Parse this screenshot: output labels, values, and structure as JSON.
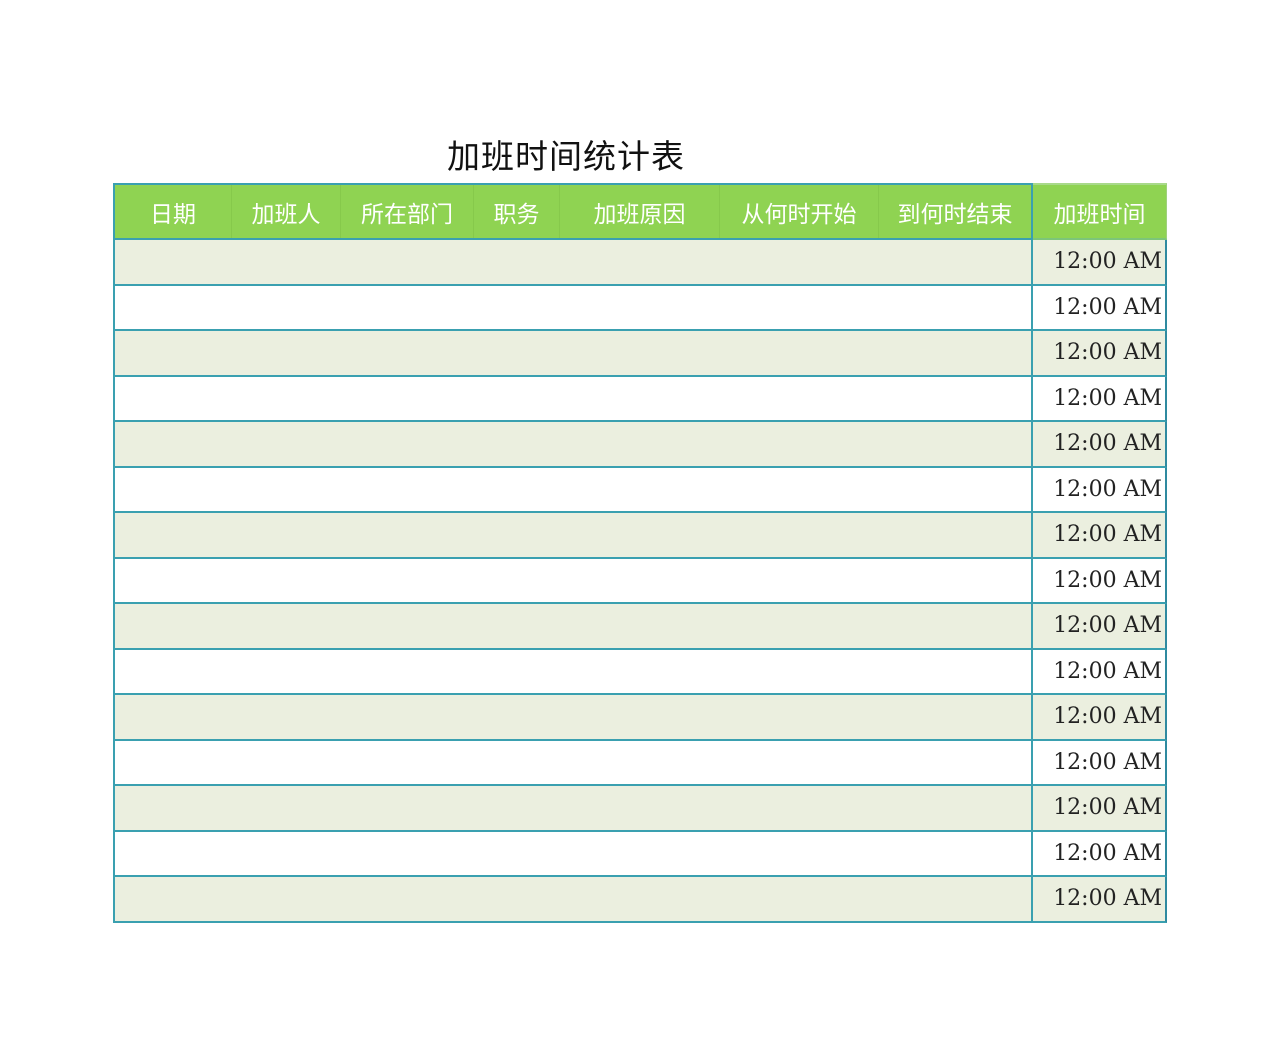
{
  "title": "加班时间统计表",
  "columns": [
    "日期",
    "加班人",
    "所在部门",
    "职务",
    "加班原因",
    "从何时开始",
    "到何时结束"
  ],
  "time_column": "加班时间",
  "rows": [
    {
      "time": "12:00 AM"
    },
    {
      "time": "12:00 AM"
    },
    {
      "time": "12:00 AM"
    },
    {
      "time": "12:00 AM"
    },
    {
      "time": "12:00 AM"
    },
    {
      "time": "12:00 AM"
    },
    {
      "time": "12:00 AM"
    },
    {
      "time": "12:00 AM"
    },
    {
      "time": "12:00 AM"
    },
    {
      "time": "12:00 AM"
    },
    {
      "time": "12:00 AM"
    },
    {
      "time": "12:00 AM"
    },
    {
      "time": "12:00 AM"
    },
    {
      "time": "12:00 AM"
    },
    {
      "time": "12:00 AM"
    }
  ],
  "colors": {
    "header_bg": "#8fd352",
    "row_shaded": "#ebefdf",
    "border": "#3aa0b0"
  }
}
